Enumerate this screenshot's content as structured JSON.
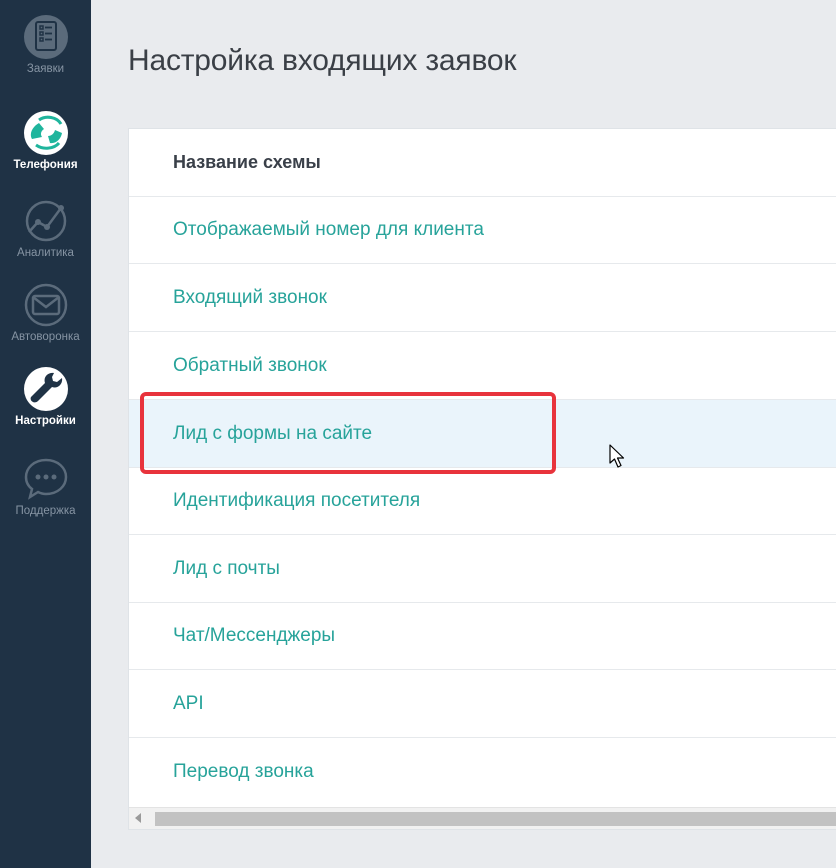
{
  "sidebar": {
    "items": [
      {
        "label": "Заявки",
        "icon": "clipboard-list-icon"
      },
      {
        "label": "Телефония",
        "icon": "phone-globe-icon"
      },
      {
        "label": "Аналитика",
        "icon": "analytics-graph-icon"
      },
      {
        "label": "Автоворонка",
        "icon": "envelope-icon"
      },
      {
        "label": "Настройки",
        "icon": "wrench-icon"
      },
      {
        "label": "Поддержка",
        "icon": "chat-bubble-icon"
      }
    ]
  },
  "page": {
    "title": "Настройка входящих заявок"
  },
  "table": {
    "header": "Название схемы",
    "rows": [
      "Отображаемый номер для клиента",
      "Входящий звонок",
      "Обратный звонок",
      "Лид с формы на сайте",
      "Идентификация посетителя",
      "Лид с почты",
      "Чат/Мессенджеры",
      "API",
      "Перевод звонка"
    ],
    "selected_row": "Лид с формы на сайте"
  },
  "colors": {
    "sidebar_bg": "#1f3245",
    "accent_teal": "#27a39a",
    "highlight_red": "#e8333c",
    "selected_row_bg": "#eaf4fb"
  }
}
